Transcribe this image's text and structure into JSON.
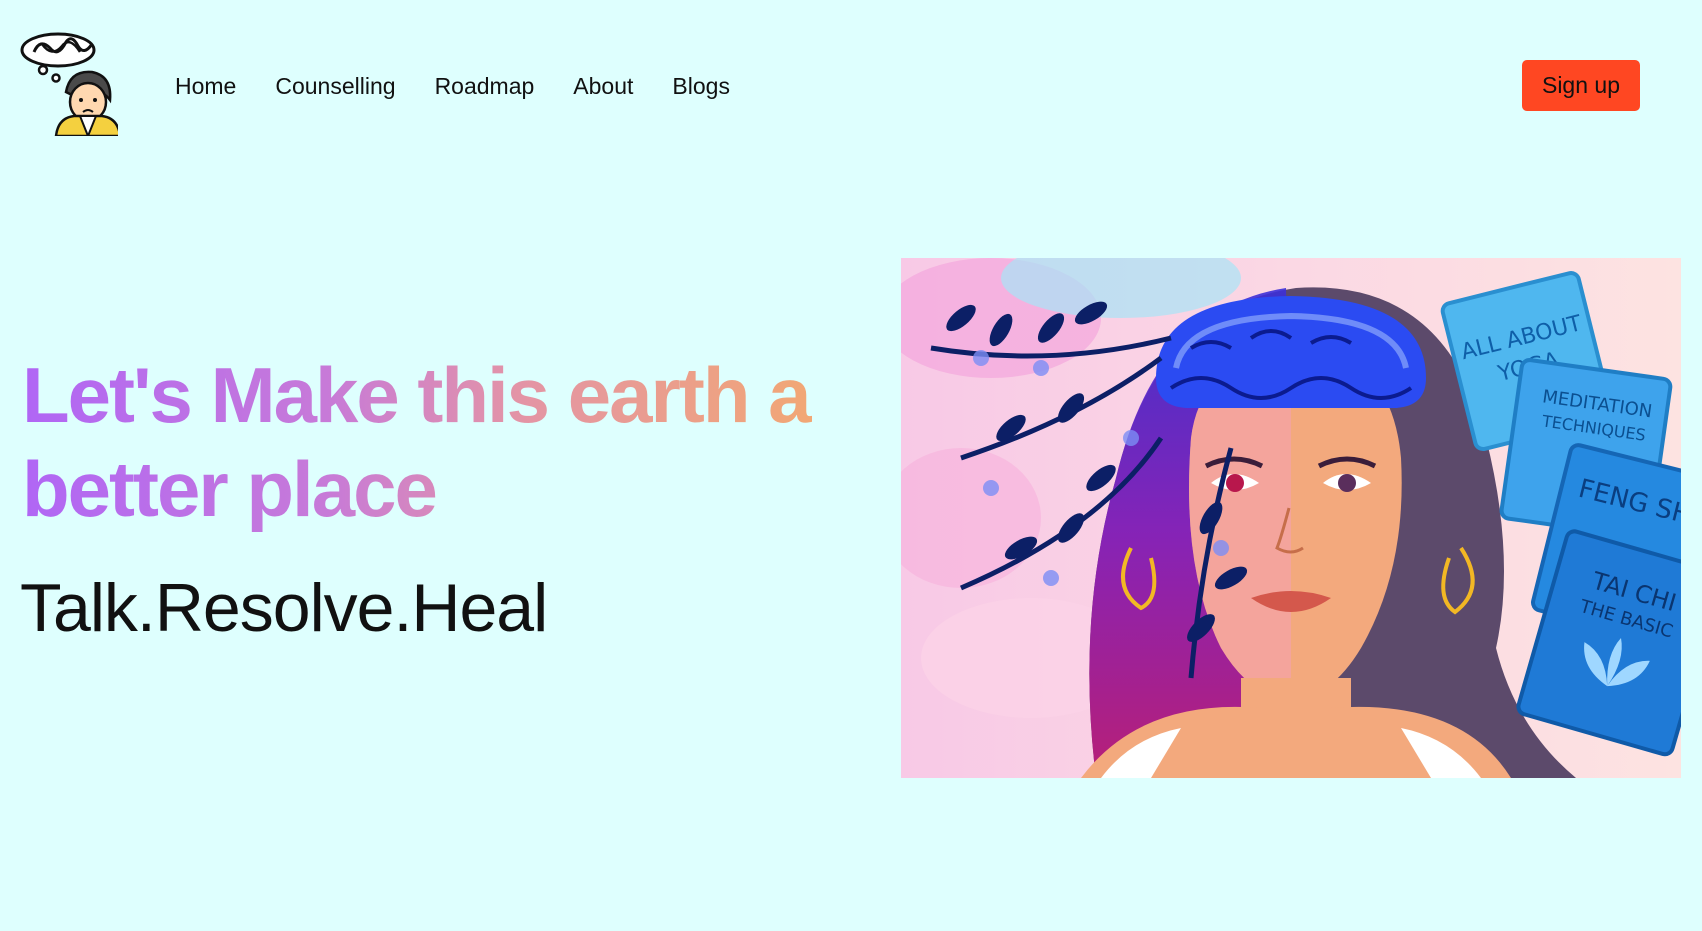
{
  "nav": {
    "logo_icon": "thinking-person-logo-icon",
    "links": [
      {
        "label": "Home"
      },
      {
        "label": "Counselling"
      },
      {
        "label": "Roadmap"
      },
      {
        "label": "About"
      },
      {
        "label": "Blogs"
      }
    ],
    "signup_label": "Sign up"
  },
  "hero": {
    "title": "Let's Make this earth a better place",
    "tagline": "Talk.Resolve.Heal",
    "illustration": {
      "icon": "mental-health-illustration",
      "book_titles": [
        {
          "line1": "ALL ABOUT",
          "line2": "YOGA"
        },
        {
          "line1": "MEDITATION",
          "line2": "TECHNIQUES"
        },
        {
          "line1": "FENG SH",
          "line2": ""
        },
        {
          "line1": "TAI CHI",
          "line2": "THE BASIC"
        }
      ]
    }
  },
  "colors": {
    "background": "#defffe",
    "signup_button": "#ff4722",
    "title_gradient_start": "#b066f5",
    "title_gradient_end": "#f2a873"
  }
}
